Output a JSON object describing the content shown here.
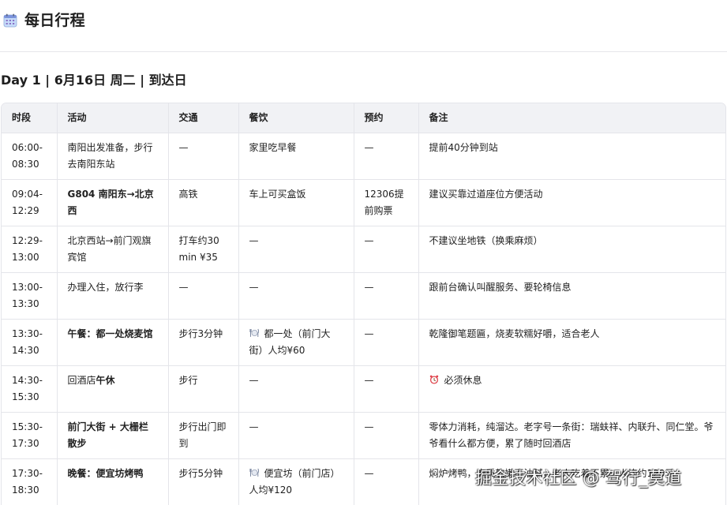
{
  "page": {
    "title": "每日行程",
    "title_icon": "calendar-icon"
  },
  "day": {
    "heading": "Day 1 | 6月16日 周二 | 到达日"
  },
  "table": {
    "headers": [
      "时段",
      "活动",
      "交通",
      "餐饮",
      "预约",
      "备注"
    ],
    "rows": [
      {
        "time": "06:00-08:30",
        "activity": "南阳出发准备，步行去南阳东站",
        "transport": "—",
        "dining": "家里吃早餐",
        "dining_icon": "",
        "reservation": "—",
        "notes": "提前40分钟到站",
        "notes_icon": ""
      },
      {
        "time": "09:04-12:29",
        "activity": "G804 南阳东→北京西",
        "transport": "高铁",
        "dining": "车上可买盒饭",
        "dining_icon": "",
        "reservation": "12306提前购票",
        "notes": "建议买靠过道座位方便活动",
        "notes_icon": ""
      },
      {
        "time": "12:29-13:00",
        "activity": "北京西站→前门观旗宾馆",
        "transport": "打车约30min ¥35",
        "dining": "—",
        "dining_icon": "",
        "reservation": "—",
        "notes": "不建议坐地铁（换乘麻烦）",
        "notes_icon": ""
      },
      {
        "time": "13:00-13:30",
        "activity": "办理入住，放行李",
        "transport": "—",
        "dining": "—",
        "dining_icon": "",
        "reservation": "—",
        "notes": "跟前台确认叫醒服务、要轮椅信息",
        "notes_icon": ""
      },
      {
        "time": "13:30-14:30",
        "activity": "午餐：都一处烧麦馆",
        "transport": "步行3分钟",
        "dining": "都一处（前门大街）人均¥60",
        "dining_icon": "plate-cutlery-icon",
        "reservation": "—",
        "notes": "乾隆御笔题匾，烧麦软糯好嚼，适合老人",
        "notes_icon": ""
      },
      {
        "time": "14:30-15:30",
        "activity_prefix": "回酒店",
        "activity_bold": "午休",
        "activity": "",
        "transport": "步行",
        "dining": "—",
        "dining_icon": "",
        "reservation": "—",
        "notes": "必须休息",
        "notes_icon": "alarm-clock-icon"
      },
      {
        "time": "15:30-17:30",
        "activity": "前门大街 + 大栅栏散步",
        "transport": "步行出门即到",
        "dining": "—",
        "dining_icon": "",
        "reservation": "—",
        "notes": "零体力消耗，纯溜达。老字号一条街：瑞蚨祥、内联升、同仁堂。爷爷看什么都方便，累了随时回酒店",
        "notes_icon": ""
      },
      {
        "time": "17:30-18:30",
        "activity": "晚餐：便宜坊烤鸭",
        "transport": "步行5分钟",
        "dining": "便宜坊（前门店）人均¥120",
        "dining_icon": "plate-cutlery-icon",
        "reservation": "—",
        "notes": "焖炉烤鸭，肉质软嫩不油腻，老人吃着不累，人均约120元",
        "notes_icon": ""
      }
    ]
  },
  "watermark": {
    "text": "掘金技术社区 @ 驾行_莫道"
  },
  "colors": {
    "header_bg": "#f1f2f5",
    "border": "#e4e5ea",
    "text": "#1f1f1f"
  }
}
